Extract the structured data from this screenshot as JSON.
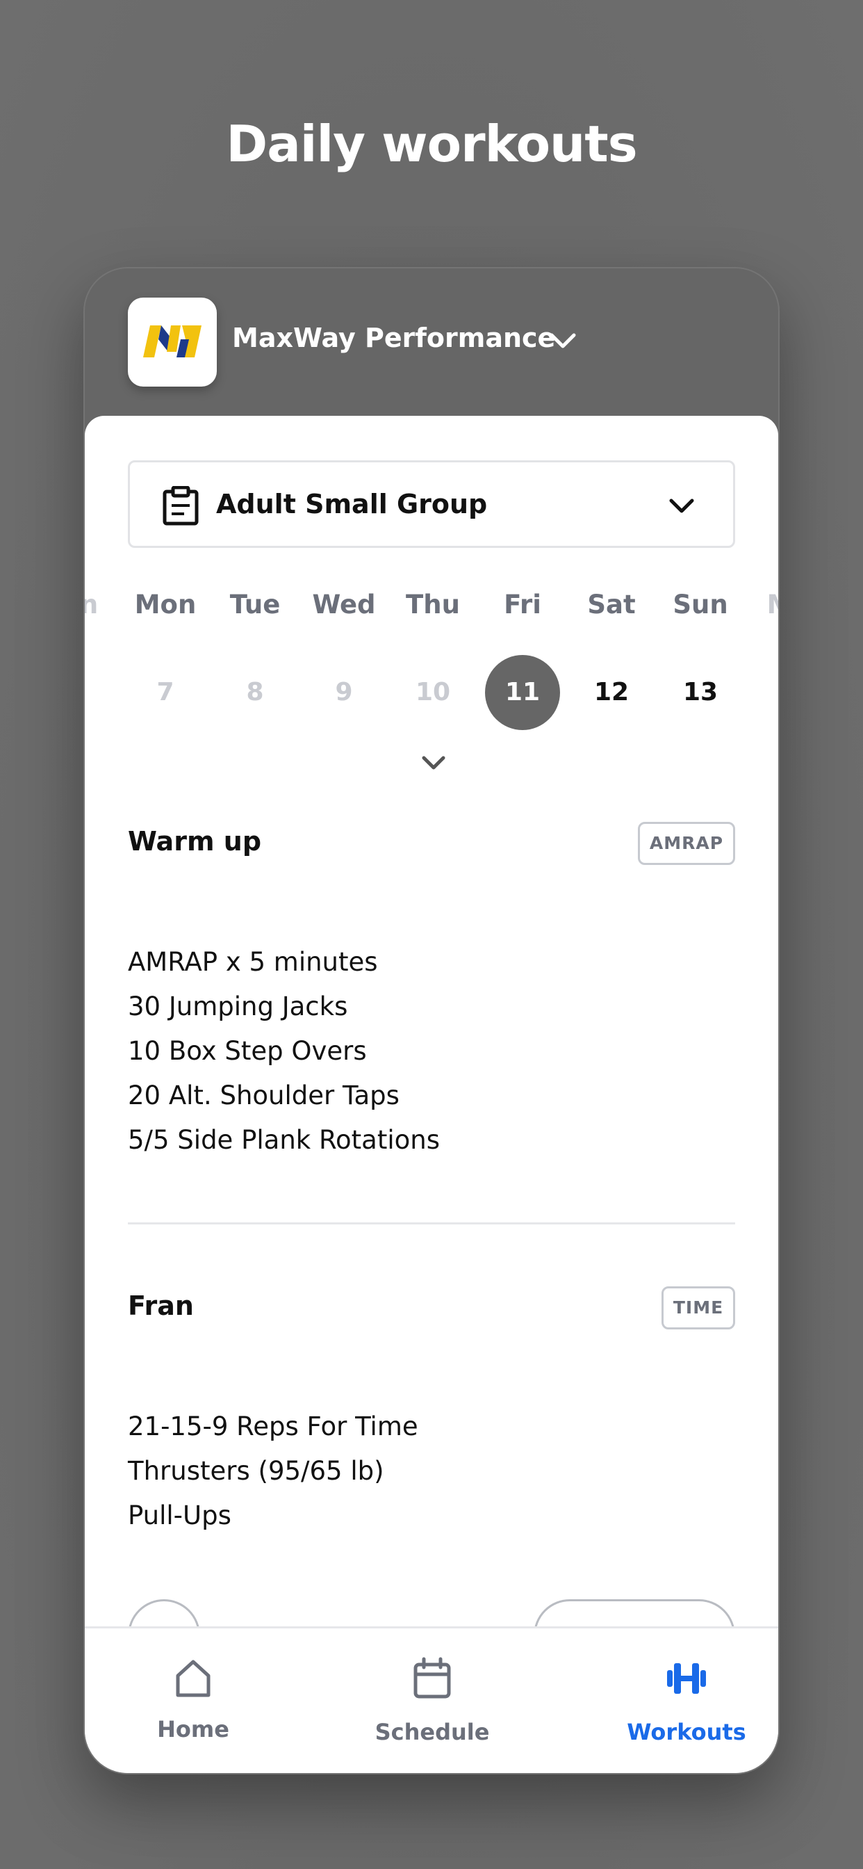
{
  "headline": "Daily workouts",
  "org": {
    "name": "MaxWay Performance",
    "logo_icon": "maxway-logo-icon"
  },
  "group_select": {
    "label": "Adult Small Group"
  },
  "calendar": {
    "days": [
      {
        "name": "Mon",
        "num": "7",
        "state": "past"
      },
      {
        "name": "Tue",
        "num": "8",
        "state": "past"
      },
      {
        "name": "Wed",
        "num": "9",
        "state": "past"
      },
      {
        "name": "Thu",
        "num": "10",
        "state": "past"
      },
      {
        "name": "Fri",
        "num": "11",
        "state": "selected"
      },
      {
        "name": "Sat",
        "num": "12",
        "state": "upcoming"
      },
      {
        "name": "Sun",
        "num": "13",
        "state": "upcoming"
      }
    ]
  },
  "sections": [
    {
      "title": "Warm up",
      "badge": "AMRAP",
      "lines": [
        "AMRAP x 5 minutes",
        "30 Jumping Jacks",
        "10 Box Step Overs",
        "20 Alt. Shoulder Taps",
        "5/5 Side Plank Rotations"
      ]
    },
    {
      "title": "Fran",
      "badge": "TIME",
      "lines": [
        "21-15-9 Reps For Time",
        "Thrusters (95/65 lb)",
        "Pull-Ups"
      ]
    }
  ],
  "tabbar": {
    "home": "Home",
    "schedule": "Schedule",
    "workouts": "Workouts",
    "active_color": "#1a6ae8",
    "inactive_color": "#6b6f7a"
  }
}
